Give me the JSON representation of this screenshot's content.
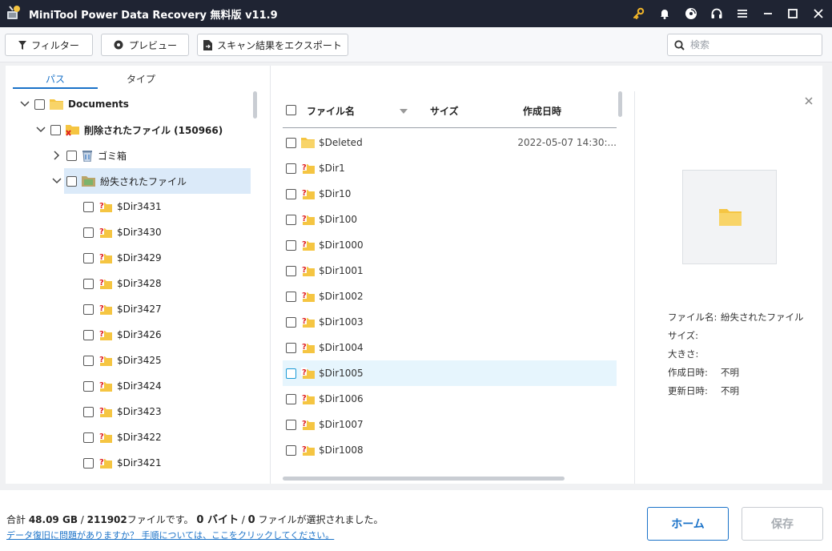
{
  "window": {
    "title": "MiniTool Power Data Recovery 無料版 v11.9"
  },
  "toolbar": {
    "filter_label": "フィルター",
    "preview_label": "プレビュー",
    "export_label": "スキャン結果をエクスポート",
    "search_placeholder": "検索"
  },
  "tabs": {
    "path_label": "パス",
    "type_label": "タイプ"
  },
  "tree": {
    "documents": "Documents",
    "deleted_files": "削除されたファイル (150966)",
    "recycle_bin": "ゴミ箱",
    "lost_files": "紛失されたファイル",
    "dirs": [
      "$Dir3431",
      "$Dir3430",
      "$Dir3429",
      "$Dir3428",
      "$Dir3427",
      "$Dir3426",
      "$Dir3425",
      "$Dir3424",
      "$Dir3423",
      "$Dir3422",
      "$Dir3421"
    ]
  },
  "file_list": {
    "columns": {
      "name": "ファイル名",
      "size": "サイズ",
      "created": "作成日時"
    },
    "rows": [
      {
        "name": "$Deleted",
        "created": "2022-05-07 14:30:..."
      },
      {
        "name": "$Dir1",
        "created": ""
      },
      {
        "name": "$Dir10",
        "created": ""
      },
      {
        "name": "$Dir100",
        "created": ""
      },
      {
        "name": "$Dir1000",
        "created": ""
      },
      {
        "name": "$Dir1001",
        "created": ""
      },
      {
        "name": "$Dir1002",
        "created": ""
      },
      {
        "name": "$Dir1003",
        "created": ""
      },
      {
        "name": "$Dir1004",
        "created": ""
      },
      {
        "name": "$Dir1005",
        "created": ""
      },
      {
        "name": "$Dir1006",
        "created": ""
      },
      {
        "name": "$Dir1007",
        "created": ""
      },
      {
        "name": "$Dir1008",
        "created": ""
      }
    ]
  },
  "preview": {
    "labels": {
      "filename": "ファイル名:",
      "size": "サイズ:",
      "dimensions": "大きさ:",
      "created": "作成日時:",
      "modified": "更新日時:"
    },
    "values": {
      "filename": "紛失されたファイル",
      "size": "",
      "dimensions": "",
      "created": "不明",
      "modified": "不明"
    }
  },
  "footer": {
    "summary_prefix": "合計 ",
    "total_size": "48.09 GB",
    "sep1": " / ",
    "total_files": "211902",
    "files_text": "ファイルです。 ",
    "selected_size": "0 バイト",
    "sep2": " / ",
    "selected_count": "0",
    "selected_text": " ファイルが選択されました。",
    "help_link": "データ復旧に問題がありますか？ 手順については、ここをクリックしてください。",
    "home_label": "ホーム",
    "save_label": "保存"
  },
  "colors": {
    "titlebar": "#1f2433",
    "accent": "#1a72c8",
    "selection": "#dbeaf9",
    "folder": "#f5c542",
    "key_icon": "#f0b429"
  }
}
